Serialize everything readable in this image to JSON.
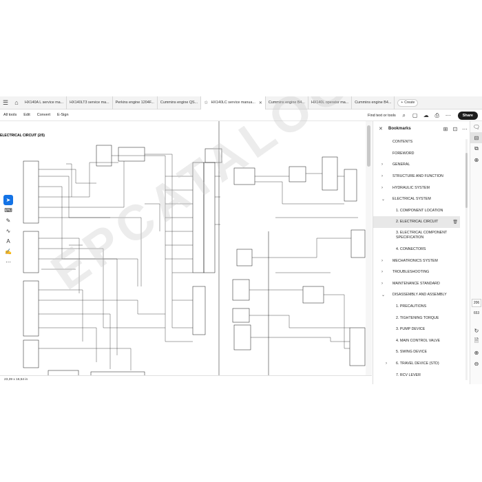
{
  "tabs": [
    {
      "label": "HX140A L service ma...",
      "active": false
    },
    {
      "label": "HX140LT3 service ma...",
      "active": false
    },
    {
      "label": "Perkins engine 1204F...",
      "active": false
    },
    {
      "label": "Cummins engine QS...",
      "active": false
    },
    {
      "label": "HX140LC service manua...",
      "active": true
    },
    {
      "label": "Cummins engine B4...",
      "active": false
    },
    {
      "label": "HX140L operator ma...",
      "active": false
    },
    {
      "label": "Cummins engine B4...",
      "active": false
    }
  ],
  "create_label": "Create",
  "menu": [
    "All tools",
    "Edit",
    "Convert",
    "E-Sign"
  ],
  "find_label": "Find text or tools",
  "share_label": "Share",
  "document": {
    "title": "ELECTRICAL CIRCUIT (2/5)",
    "watermark": "EPCATALOG.COM",
    "page_size": "23,39 x 16,54 in"
  },
  "bookmarks": {
    "title": "Bookmarks",
    "items": [
      {
        "label": "CONTENTS",
        "expandable": false,
        "level": 0
      },
      {
        "label": "FOREWORD",
        "expandable": false,
        "level": 0
      },
      {
        "label": "GENERAL",
        "expandable": true,
        "level": 0
      },
      {
        "label": "STRUCTURE AND FUNCTION",
        "expandable": true,
        "level": 0
      },
      {
        "label": "HYDRAULIC SYSTEM",
        "expandable": true,
        "level": 0
      },
      {
        "label": "ELECTRICAL SYSTEM",
        "expandable": true,
        "expanded": true,
        "level": 0
      },
      {
        "label": "1. COMPONENT LOCATION",
        "expandable": false,
        "level": 1
      },
      {
        "label": "2. ELECTRICAL CIRCUIT",
        "expandable": false,
        "level": 1,
        "selected": true
      },
      {
        "label": "3. ELECTRICAL COMPONENT SPECIFICATION",
        "expandable": false,
        "level": 1
      },
      {
        "label": "4. CONNECTORS",
        "expandable": false,
        "level": 1
      },
      {
        "label": "MECHATRONICS SYSTEM",
        "expandable": true,
        "level": 0
      },
      {
        "label": "TROUBLESHOOTING",
        "expandable": true,
        "level": 0
      },
      {
        "label": "MAINTENANCE STANDARD",
        "expandable": true,
        "level": 0
      },
      {
        "label": "DISASSEMBLY AND ASSEMBLY",
        "expandable": true,
        "expanded": true,
        "level": 0
      },
      {
        "label": "1. PRECAUTIONS",
        "expandable": false,
        "level": 1
      },
      {
        "label": "2. TIGHTENING TORQUE",
        "expandable": false,
        "level": 1
      },
      {
        "label": "3. PUMP DEVICE",
        "expandable": false,
        "level": 1
      },
      {
        "label": "4. MAIN CONTROL VALVE",
        "expandable": false,
        "level": 1
      },
      {
        "label": "5. SWING DEVICE",
        "expandable": false,
        "level": 1
      },
      {
        "label": "6. TRAVEL DEVICE (STD)",
        "expandable": true,
        "level": 1
      },
      {
        "label": "7. RCV LEVER",
        "expandable": false,
        "level": 1
      }
    ]
  },
  "page_nav": {
    "current": "206",
    "total": "653"
  },
  "colors": {
    "accent": "#1473e6",
    "share_bg": "#1e1e1e"
  }
}
